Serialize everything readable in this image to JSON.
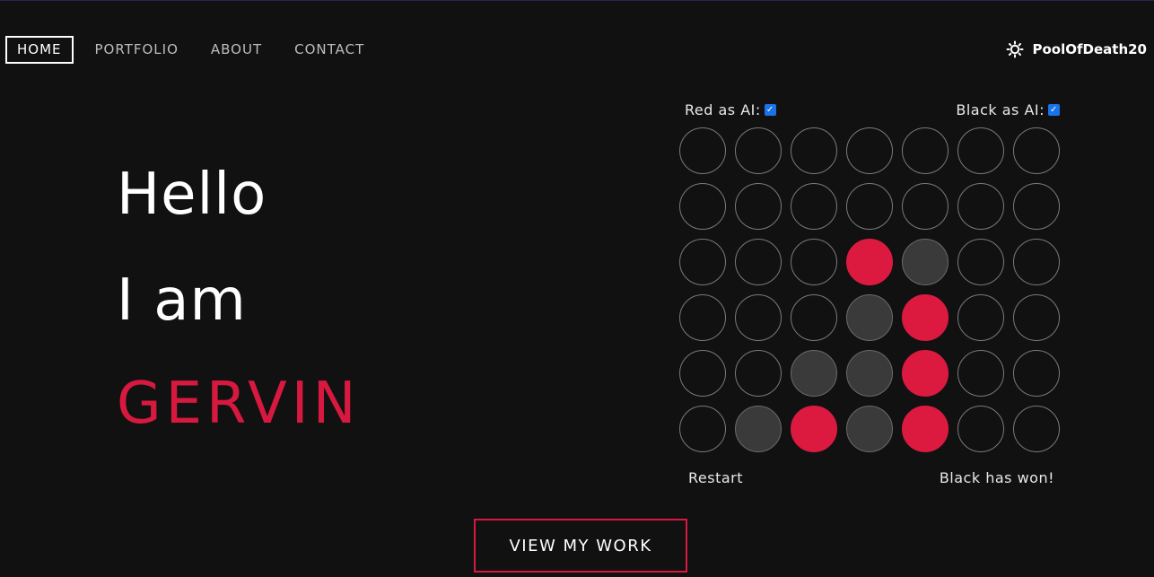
{
  "nav": {
    "items": [
      {
        "label": "HOME",
        "active": true
      },
      {
        "label": "PORTFOLIO",
        "active": false
      },
      {
        "label": "ABOUT",
        "active": false
      },
      {
        "label": "CONTACT",
        "active": false
      }
    ]
  },
  "user": {
    "icon": "sun-icon",
    "username": "PoolOfDeath20"
  },
  "hero": {
    "line1": "Hello",
    "line2": "I am",
    "name": "GERVIN",
    "name_color": "#d7193f"
  },
  "game": {
    "red_ai_label": "Red as AI:",
    "red_ai_checked": true,
    "black_ai_label": "Black as AI:",
    "black_ai_checked": true,
    "board": [
      [
        "",
        "",
        "",
        "",
        "",
        "",
        ""
      ],
      [
        "",
        "",
        "",
        "",
        "",
        "",
        ""
      ],
      [
        "",
        "",
        "",
        "R",
        "B",
        "",
        ""
      ],
      [
        "",
        "",
        "",
        "B",
        "R",
        "",
        ""
      ],
      [
        "",
        "",
        "B",
        "B",
        "R",
        "",
        ""
      ],
      [
        "",
        "B",
        "R",
        "B",
        "R",
        "",
        ""
      ]
    ],
    "colors": {
      "red": "#dc1a40",
      "black": "#3a3a3a",
      "empty_border": "#7a7a7a"
    },
    "restart_label": "Restart",
    "status": "Black has won!"
  },
  "cta": {
    "label": "VIEW MY WORK",
    "border_color": "#d7193f"
  }
}
